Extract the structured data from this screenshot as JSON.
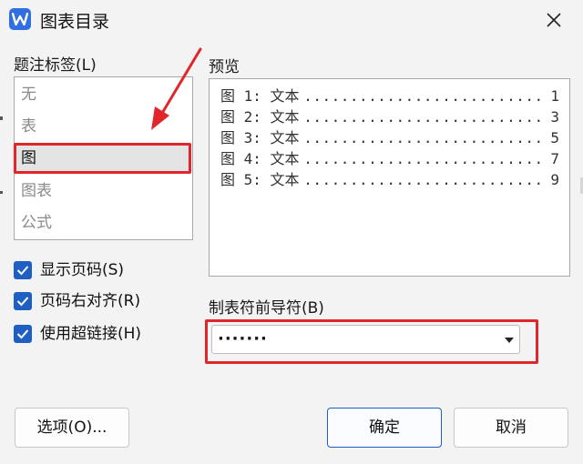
{
  "window": {
    "title": "图表目录",
    "icon": "wps-writer-icon"
  },
  "caption_labels": {
    "label": "题注标签(L)",
    "items": [
      "无",
      "表",
      "图",
      "图表",
      "公式"
    ],
    "selected_index": 2
  },
  "options": {
    "show_page_numbers": {
      "label": "显示页码(S)",
      "checked": true
    },
    "right_align_page_numbers": {
      "label": "页码右对齐(R)",
      "checked": true
    },
    "use_hyperlinks": {
      "label": "使用超链接(H)",
      "checked": true
    }
  },
  "preview": {
    "label": "预览",
    "entries": [
      {
        "text": "图 1: 文本",
        "page": "1"
      },
      {
        "text": "图 2: 文本",
        "page": "3"
      },
      {
        "text": "图 3: 文本",
        "page": "5"
      },
      {
        "text": "图 4: 文本",
        "page": "7"
      },
      {
        "text": "图 5: 文本",
        "page": "9"
      }
    ]
  },
  "tab_leader": {
    "label": "制表符前导符(B)",
    "value": "·······"
  },
  "buttons": {
    "options": "选项(O)...",
    "ok": "确定",
    "cancel": "取消"
  },
  "colors": {
    "accent": "#1f5fc4",
    "annotation_red": "#e0262b",
    "app_icon": "#2f6fe0"
  }
}
